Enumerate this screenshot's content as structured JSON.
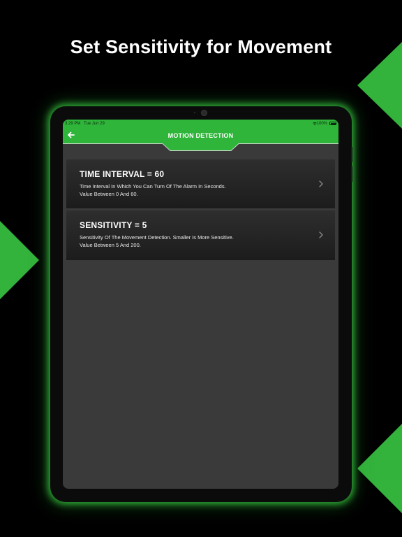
{
  "headline": "Set Sensitivity for Movement",
  "colors": {
    "accent_green": "#33b23c",
    "navbar_green": "#2fb53a",
    "screen_background": "#3a3a3a",
    "row_background": "#262626"
  },
  "status_bar": {
    "time": "3:29 PM",
    "date": "Tue Jun 29",
    "battery": "100%",
    "icons": [
      "wifi-icon",
      "battery-icon"
    ]
  },
  "nav": {
    "title": "MOTION DETECTION",
    "back_icon": "arrow-left-icon"
  },
  "settings": [
    {
      "title": "TIME INTERVAL = 60",
      "description": "Time Interval In Which You Can Turn Of The Alarm In Seconds. Value Between 0 And 60.",
      "icon": "chevron-right-icon"
    },
    {
      "title": "SENSITIVITY = 5",
      "description": "Sensitivity Of The Movement Detection. Smaller Is More Sensitive. Value Between 5 And 200.",
      "icon": "chevron-right-icon"
    }
  ]
}
